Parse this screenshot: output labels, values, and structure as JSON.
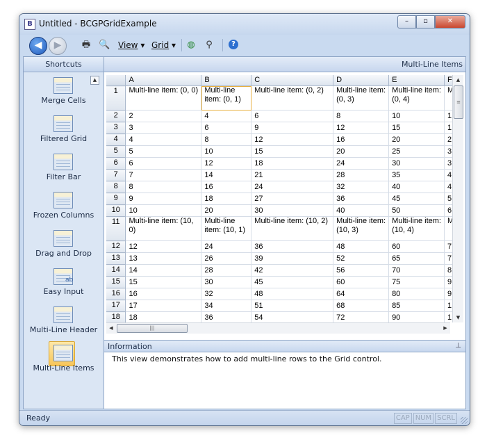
{
  "window": {
    "title": "Untitled - BCGPGridExample",
    "app_icon_glyph": "B"
  },
  "window_controls": {
    "minimize": "–",
    "maximize": "▫",
    "close": "✕"
  },
  "toolbar": {
    "back_glyph": "◀",
    "forward_glyph": "▶",
    "view_label": "View",
    "grid_label": "Grid",
    "dropdown_glyph": "▾",
    "help_glyph": "?",
    "icons": [
      "print-icon",
      "print-preview-icon",
      "globe-icon",
      "find-icon",
      "help-icon"
    ]
  },
  "shortcuts": {
    "header": "Shortcuts",
    "scroll_up_glyph": "▲",
    "items": [
      {
        "label": "Merge Cells",
        "icon": "merge-cells-icon"
      },
      {
        "label": "Filtered Grid",
        "icon": "filtered-grid-icon"
      },
      {
        "label": "Filter Bar",
        "icon": "filter-bar-icon"
      },
      {
        "label": "Frozen Columns",
        "icon": "frozen-columns-icon"
      },
      {
        "label": "Drag and Drop",
        "icon": "drag-and-drop-icon"
      },
      {
        "label": "Easy Input",
        "icon": "easy-input-icon",
        "badge": "ab"
      },
      {
        "label": "Multi-Line Header",
        "icon": "multi-line-header-icon"
      },
      {
        "label": "Multi-Line Items",
        "icon": "multi-line-items-icon",
        "active": true
      }
    ]
  },
  "main": {
    "header": "Multi-Line Items"
  },
  "grid": {
    "columns": [
      "A",
      "B",
      "C",
      "D",
      "E",
      "F"
    ],
    "rows": [
      {
        "num": "1",
        "tall": true,
        "cells": [
          "Multi-line item: (0, 0)",
          "Multi-line item: (0, 1)",
          "Multi-line item: (0, 2)",
          "Multi-line item: (0, 3)",
          "Multi-line item: (0, 4)",
          "M"
        ]
      },
      {
        "num": "2",
        "cells": [
          "2",
          "4",
          "6",
          "8",
          "10",
          "1"
        ]
      },
      {
        "num": "3",
        "cells": [
          "3",
          "6",
          "9",
          "12",
          "15",
          "1"
        ]
      },
      {
        "num": "4",
        "cells": [
          "4",
          "8",
          "12",
          "16",
          "20",
          "2"
        ]
      },
      {
        "num": "5",
        "cells": [
          "5",
          "10",
          "15",
          "20",
          "25",
          "3"
        ]
      },
      {
        "num": "6",
        "cells": [
          "6",
          "12",
          "18",
          "24",
          "30",
          "3"
        ]
      },
      {
        "num": "7",
        "cells": [
          "7",
          "14",
          "21",
          "28",
          "35",
          "4"
        ]
      },
      {
        "num": "8",
        "cells": [
          "8",
          "16",
          "24",
          "32",
          "40",
          "4"
        ]
      },
      {
        "num": "9",
        "cells": [
          "9",
          "18",
          "27",
          "36",
          "45",
          "5"
        ]
      },
      {
        "num": "10",
        "cells": [
          "10",
          "20",
          "30",
          "40",
          "50",
          "6"
        ]
      },
      {
        "num": "11",
        "tall": true,
        "cells": [
          "Multi-line item: (10, 0)",
          "Multi-line item: (10, 1)",
          "Multi-line item: (10, 2)",
          "Multi-line item: (10, 3)",
          "Multi-line item: (10, 4)",
          "M"
        ]
      },
      {
        "num": "12",
        "cells": [
          "12",
          "24",
          "36",
          "48",
          "60",
          "7"
        ]
      },
      {
        "num": "13",
        "cells": [
          "13",
          "26",
          "39",
          "52",
          "65",
          "7"
        ]
      },
      {
        "num": "14",
        "cells": [
          "14",
          "28",
          "42",
          "56",
          "70",
          "8"
        ]
      },
      {
        "num": "15",
        "cells": [
          "15",
          "30",
          "45",
          "60",
          "75",
          "9"
        ]
      },
      {
        "num": "16",
        "cells": [
          "16",
          "32",
          "48",
          "64",
          "80",
          "9"
        ]
      },
      {
        "num": "17",
        "cells": [
          "17",
          "34",
          "51",
          "68",
          "85",
          "1"
        ]
      },
      {
        "num": "18",
        "cells": [
          "18",
          "36",
          "54",
          "72",
          "90",
          "1"
        ]
      }
    ],
    "selected_cell": {
      "row": "1",
      "column": "B"
    },
    "scroll_glyphs": {
      "up": "▲",
      "down": "▼",
      "left": "◀",
      "right": "▶",
      "thumb": "≡",
      "hthumb": "|||"
    }
  },
  "information": {
    "header": "Information",
    "pin_glyph": "⊥",
    "text": "This view demonstrates how to add multi-line rows to the Grid control."
  },
  "status": {
    "text": "Ready",
    "indicators": [
      "CAP",
      "NUM",
      "SCRL"
    ]
  }
}
